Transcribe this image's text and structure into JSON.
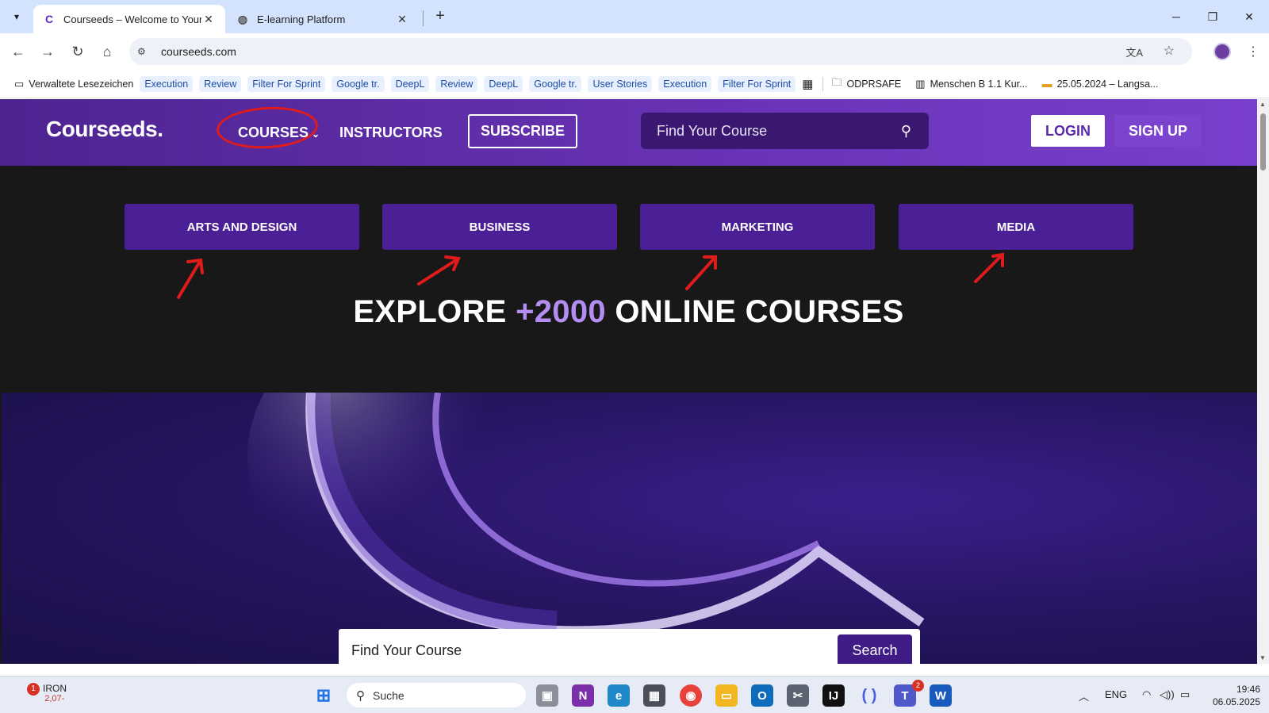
{
  "browser": {
    "tabs": [
      {
        "title": "Courseeds – Welcome to Your C",
        "active": true
      },
      {
        "title": "E-learning Platform",
        "active": false
      }
    ],
    "url": "courseeds.com",
    "bookmarks": [
      {
        "label": "Verwaltete Lesezeichen",
        "icon": "managed-bookmarks-icon"
      },
      {
        "label": "Execution"
      },
      {
        "label": "Review"
      },
      {
        "label": "Filter For Sprint"
      },
      {
        "label": "Google tr."
      },
      {
        "label": "DeepL"
      },
      {
        "label": "Review"
      },
      {
        "label": "DeepL"
      },
      {
        "label": "Google tr."
      },
      {
        "label": "User Stories"
      },
      {
        "label": "Execution"
      },
      {
        "label": "Filter For Sprint"
      },
      {
        "label": "ODPRSAFE",
        "icon": "folder-icon"
      },
      {
        "label": "Menschen B 1.1 Kur...",
        "icon": "library-icon"
      },
      {
        "label": "25.05.2024 – Langsa...",
        "icon": "event-icon"
      }
    ]
  },
  "site": {
    "logo": "Courseeds.",
    "nav": {
      "courses": "COURSES",
      "instructors": "INSTRUCTORS",
      "subscribe": "SUBSCRIBE"
    },
    "search_placeholder": "Find Your Course",
    "login": "LOGIN",
    "signup": "SIGN UP",
    "categories": [
      "ARTS AND DESIGN",
      "BUSINESS",
      "MARKETING",
      "MEDIA"
    ],
    "headline": {
      "pre": "EXPLORE ",
      "highlight": "+2000",
      "post": " ONLINE COURSES"
    },
    "hero_search": {
      "placeholder": "Find Your Course",
      "button": "Search"
    }
  },
  "taskbar": {
    "weather": {
      "label": "IRON",
      "value": " 2,07-",
      "badge": "1"
    },
    "search_placeholder": "Suche",
    "teams_badge": "2",
    "language": "ENG",
    "time": "19:46",
    "date": "06.05.2025"
  },
  "colors": {
    "brand_purple": "#5a2aa8",
    "category_bg": "#4b1f95",
    "annotation_red": "#e01b1b",
    "highlight_purple": "#b38df0"
  }
}
